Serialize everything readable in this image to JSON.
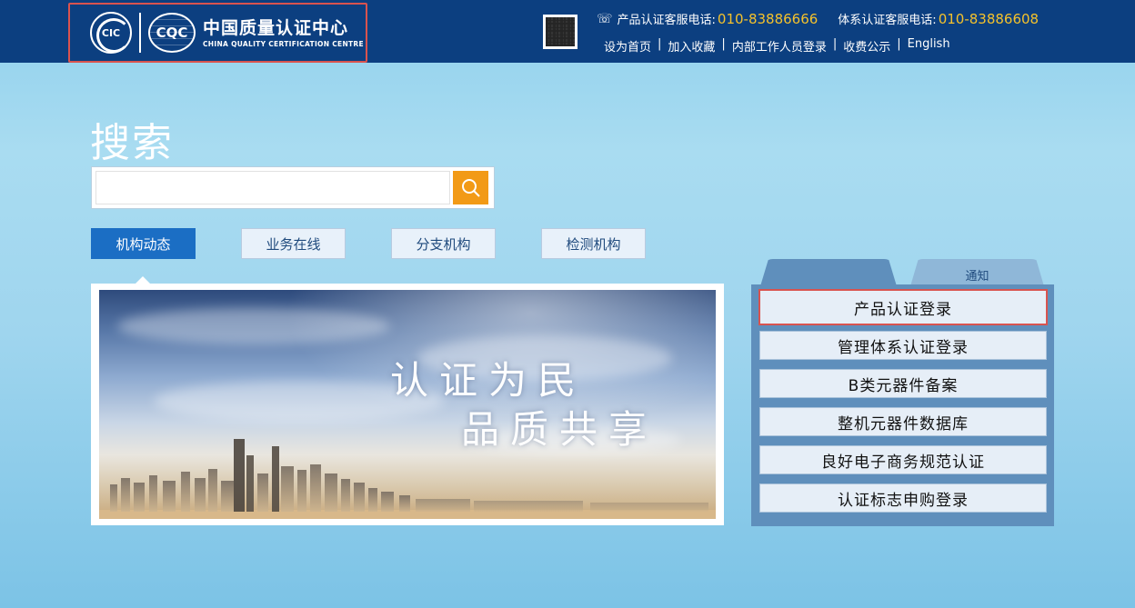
{
  "header": {
    "logo": {
      "cic_text": "CIC",
      "cqc_text": "CQC",
      "name_cn": "中国质量认证中心",
      "name_en": "CHINA QUALITY CERTIFICATION CENTRE"
    },
    "phones": {
      "product_label": "产品认证客服电话:",
      "product_number": "010-83886666",
      "system_label": "体系认证客服电话:",
      "system_number": "010-83886608"
    },
    "links": [
      {
        "label": "设为首页"
      },
      {
        "label": "加入收藏"
      },
      {
        "label": "内部工作人员登录"
      },
      {
        "label": "收费公示"
      },
      {
        "label": "English"
      }
    ]
  },
  "search": {
    "title": "搜索",
    "placeholder": "",
    "value": ""
  },
  "tabs": [
    {
      "label": "机构动态",
      "active": true
    },
    {
      "label": "业务在线",
      "active": false
    },
    {
      "label": "分支机构",
      "active": false
    },
    {
      "label": "检测机构",
      "active": false
    }
  ],
  "banner": {
    "line1": "认证为民",
    "line2": "品质共享"
  },
  "panel": {
    "tabs": [
      {
        "label": "",
        "active": true
      },
      {
        "label": "通知",
        "active": false
      }
    ],
    "buttons": [
      {
        "label": "产品认证登录",
        "highlighted": true
      },
      {
        "label": "管理体系认证登录",
        "highlighted": false
      },
      {
        "label": "B类元器件备案",
        "highlighted": false
      },
      {
        "label": "整机元器件数据库",
        "highlighted": false
      },
      {
        "label": "良好电子商务规范认证",
        "highlighted": false
      },
      {
        "label": "认证标志申购登录",
        "highlighted": false
      }
    ]
  },
  "colors": {
    "header_bg": "#0c3f80",
    "phone_number": "#f5c22b",
    "search_button": "#f29a16",
    "active_tab": "#1b6ec4",
    "highlight_border": "#d9534f"
  }
}
